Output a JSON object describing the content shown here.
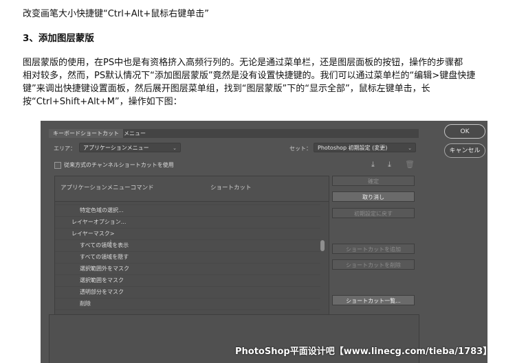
{
  "article": {
    "line1": "改变画笔大小快捷键“Ctrl+Alt+鼠标右键单击”",
    "heading": "3、添加图层蒙版",
    "para": [
      "图层蒙版的使用，在PS中也是有资格挤入高频行列的。无论是通过菜单栏，还是图层面板的按钮，操作的步骤都",
      "相对较多，然而，PS默认情况下“添加图层蒙版”竟然是没有设置快捷键的。我们可以通过菜单栏的“编辑>键盘快捷",
      "键”来调出快捷键设置面板，然后展开图层菜单组，找到“图层蒙版”下的“显示全部”，鼠标左键单击，长",
      "按“Ctrl+Shift+Alt+M”，操作如下图："
    ]
  },
  "dialog": {
    "tabs": [
      "キーボードショートカット",
      "メニュー"
    ],
    "area_label": "エリア：",
    "area_value": "アプリケーションメニュー",
    "set_label": "セット：",
    "set_value": "Photoshop 初期設定 (変更)",
    "legacy_checkbox": "従来方式のチャンネルショートカットを使用",
    "col_command": "アプリケーションメニューコマンド",
    "col_shortcut": "ショートカット",
    "rows": [
      {
        "text": "特定色域の選択...",
        "indent": 2
      },
      {
        "text": "レイヤーオプション...",
        "indent": 1
      },
      {
        "text": "レイヤーマスク>",
        "indent": 1
      },
      {
        "text": "すべての領域を表示",
        "indent": 2
      },
      {
        "text": "すべての領域を隠す",
        "indent": 2
      },
      {
        "text": "選択範囲外をマスク",
        "indent": 2
      },
      {
        "text": "選択範囲をマスク",
        "indent": 2
      },
      {
        "text": "透明部分をマスク",
        "indent": 2
      },
      {
        "text": "削除",
        "indent": 2
      }
    ],
    "buttons": {
      "confirm": "確定",
      "undo": "取り消し",
      "reset": "初期設定に戻す",
      "add": "ショートカットを追加",
      "delete": "ショートカットを削除",
      "summary": "ショートカット一覧..."
    },
    "ok": "OK",
    "cancel": "キャンセル",
    "icons": [
      "save-set-icon",
      "new-set-icon",
      "trash-icon"
    ]
  },
  "watermark": "PhotoShop平面设计吧【www.linecg.com/tieba/1783】"
}
